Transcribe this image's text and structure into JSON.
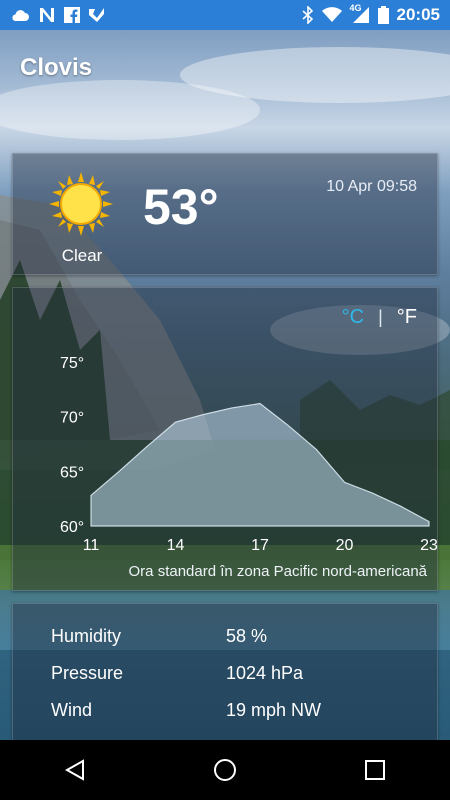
{
  "status_bar": {
    "time": "20:05",
    "network": "4G",
    "left_icons": [
      "cloud-icon",
      "n-logo-icon",
      "facebook-icon",
      "check-icon"
    ],
    "right_icons": [
      "bluetooth-icon",
      "wifi-icon",
      "signal-icon",
      "battery-icon"
    ]
  },
  "location": {
    "city": "Clovis"
  },
  "current": {
    "temperature": "53°",
    "condition": "Clear",
    "datetime": "10 Apr 09:58",
    "icon": "sun-icon"
  },
  "units": {
    "celsius": "°C",
    "separator": "|",
    "fahrenheit": "°F",
    "selected": "celsius"
  },
  "chart_data": {
    "type": "area",
    "x": [
      11,
      12,
      13,
      14,
      15,
      16,
      17,
      18,
      19,
      20,
      21,
      22,
      23
    ],
    "xticks": [
      "11",
      "14",
      "17",
      "20",
      "23"
    ],
    "yticks": [
      "60°",
      "65°",
      "70°",
      "75°"
    ],
    "ylim": [
      60,
      75
    ],
    "series": [
      {
        "values": [
          62.8,
          65.0,
          67.3,
          69.5,
          70.2,
          70.8,
          71.2,
          69.2,
          67.0,
          64.0,
          63.0,
          61.8,
          60.4
        ]
      }
    ],
    "timezone_label": "Ora standard în zona Pacific nord-americană"
  },
  "details": [
    {
      "label": "Humidity",
      "value": "58 %"
    },
    {
      "label": "Pressure",
      "value": "1024 hPa"
    },
    {
      "label": "Wind",
      "value": "19 mph NW"
    }
  ],
  "nav": {
    "icons": [
      "back-icon",
      "home-icon",
      "recents-icon"
    ]
  },
  "colors": {
    "status_bar": "#2b7fd6",
    "unit_selected": "#2fb8e8"
  }
}
